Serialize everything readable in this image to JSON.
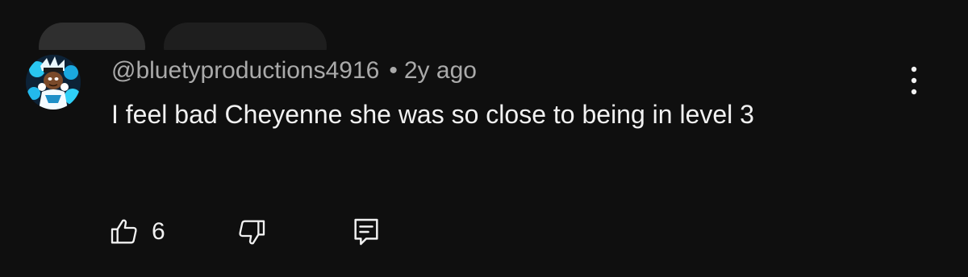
{
  "comment": {
    "handle": "@bluetyproductions4916",
    "separator": "•",
    "age": "2y ago",
    "text": "I feel bad Cheyenne she was so close to being in level 3",
    "likes": "6"
  },
  "icons": {
    "avatar": "cartoon-character-avatar",
    "menu": "more-vert-icon",
    "like": "thumbs-up-icon",
    "dislike": "thumbs-down-icon",
    "reply": "reply-comment-icon"
  },
  "colors": {
    "background": "#0f0f0f",
    "text_primary": "#f1f1f1",
    "text_secondary": "#aaaaaa",
    "chip": "#272727"
  }
}
